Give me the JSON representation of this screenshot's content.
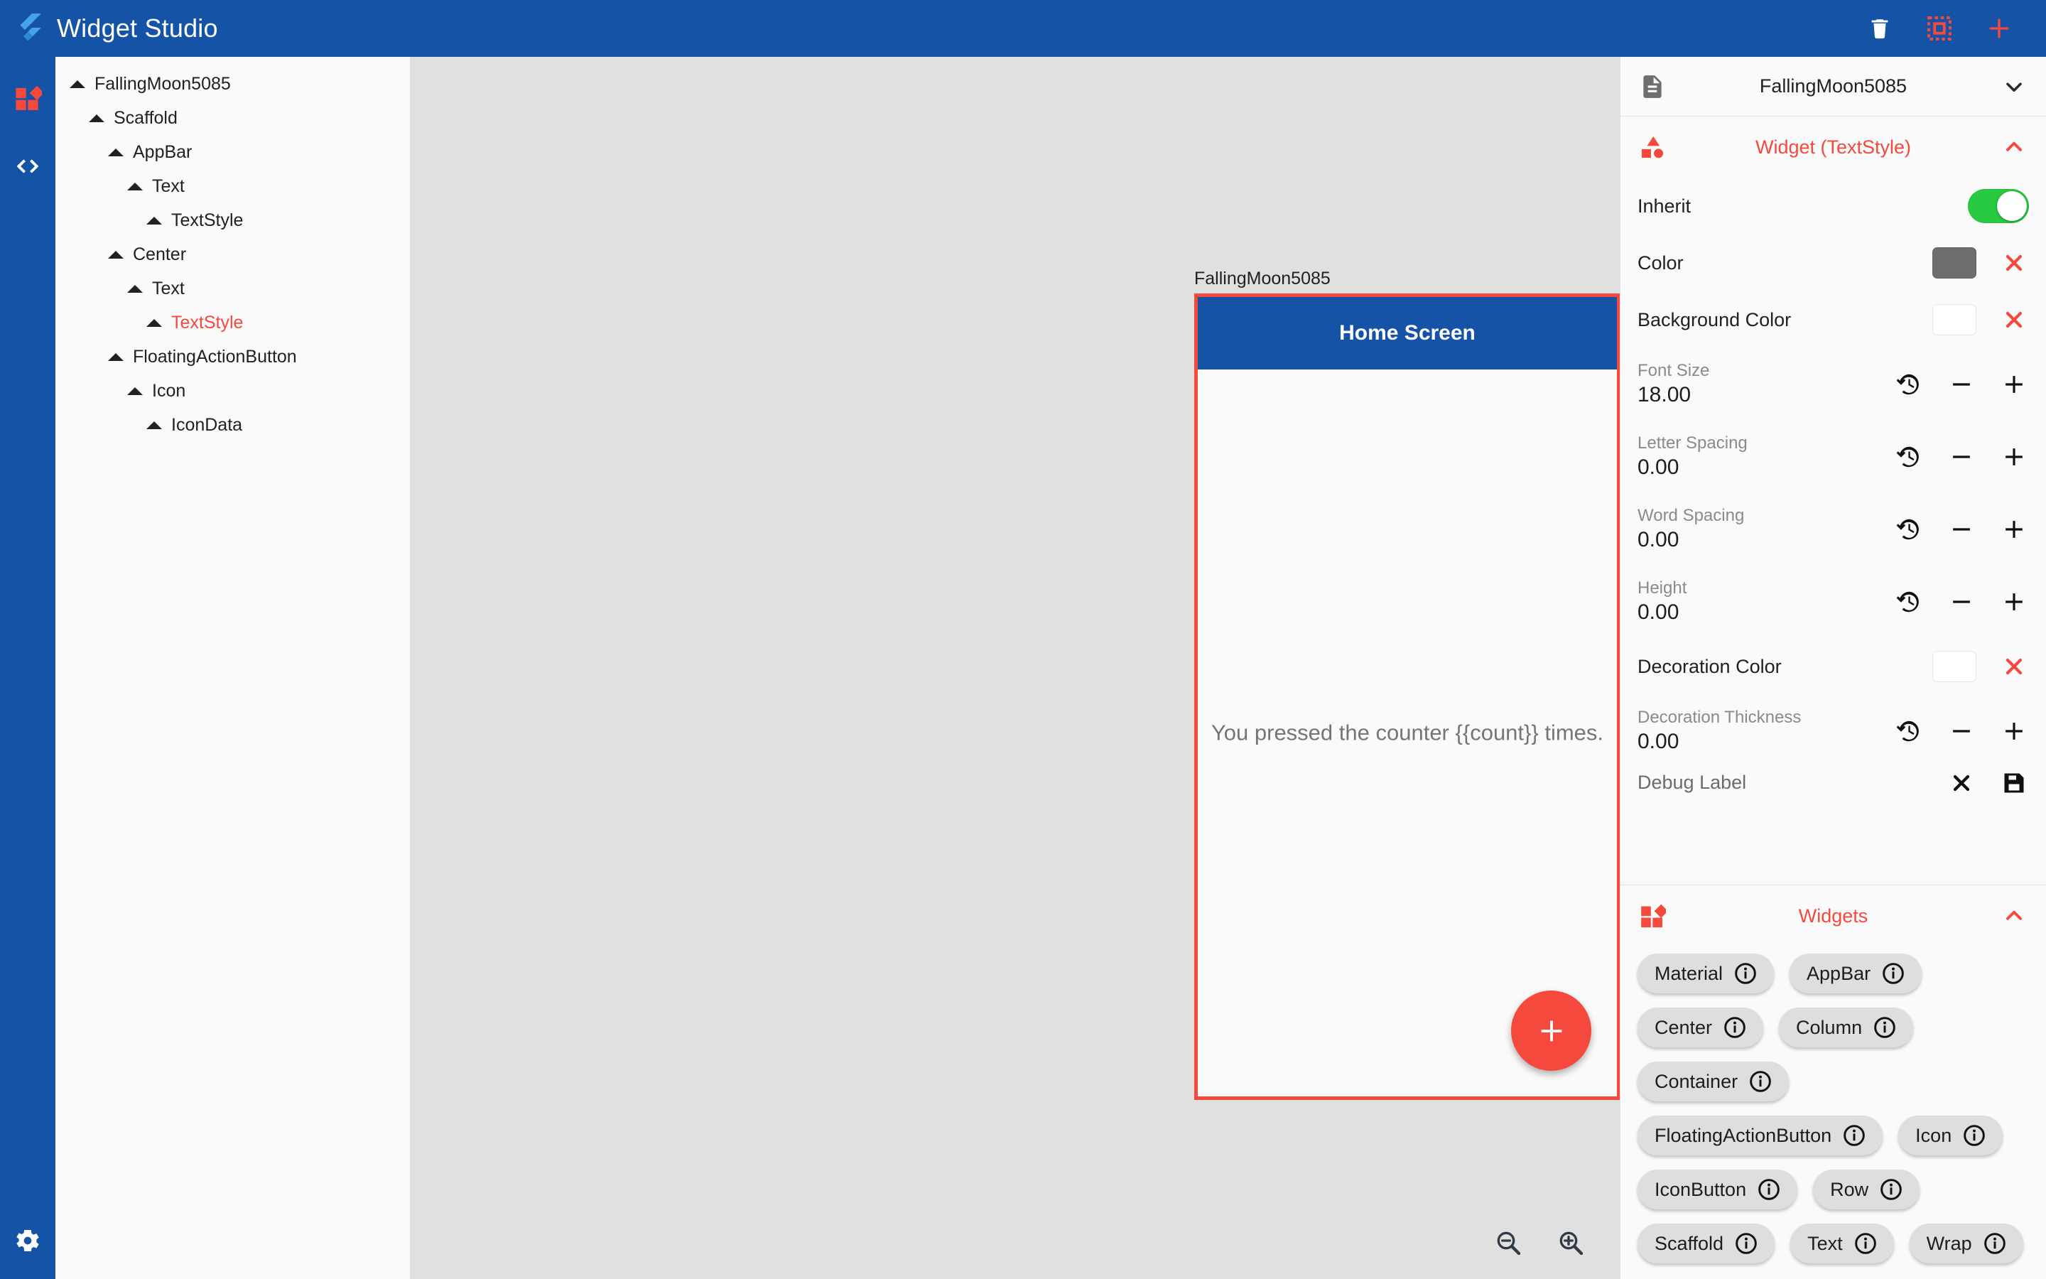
{
  "app": {
    "title": "Widget Studio",
    "brand_color": "#1553a6",
    "accent_color": "#f4493c"
  },
  "topbar": {
    "actions": [
      {
        "name": "delete",
        "icon": "trash-icon"
      },
      {
        "name": "select-region",
        "icon": "dashed-square-icon"
      },
      {
        "name": "add",
        "icon": "plus-icon"
      }
    ]
  },
  "rail": {
    "items": [
      {
        "name": "widgets",
        "icon": "widgets-icon",
        "active": true
      },
      {
        "name": "code",
        "icon": "code-icon",
        "active": false
      }
    ],
    "settings": {
      "name": "settings",
      "icon": "gear-icon"
    }
  },
  "tree": {
    "items": [
      {
        "label": "FallingMoon5085",
        "depth": 0,
        "selected": false
      },
      {
        "label": "Scaffold",
        "depth": 1,
        "selected": false
      },
      {
        "label": "AppBar",
        "depth": 2,
        "selected": false
      },
      {
        "label": "Text",
        "depth": 3,
        "selected": false
      },
      {
        "label": "TextStyle",
        "depth": 4,
        "selected": false
      },
      {
        "label": "Center",
        "depth": 2,
        "selected": false
      },
      {
        "label": "Text",
        "depth": 3,
        "selected": false
      },
      {
        "label": "TextStyle",
        "depth": 4,
        "selected": true
      },
      {
        "label": "FloatingActionButton",
        "depth": 2,
        "selected": false
      },
      {
        "label": "Icon",
        "depth": 3,
        "selected": false
      },
      {
        "label": "IconData",
        "depth": 4,
        "selected": false
      }
    ]
  },
  "canvas": {
    "device_label": "FallingMoon5085",
    "appbar_title": "Home Screen",
    "center_text": "You pressed the counter {{count}} times.",
    "fab_icon": "plus-icon",
    "zoom_out": "zoom-out-icon",
    "zoom_in": "zoom-in-icon"
  },
  "inspector": {
    "header": {
      "title": "FallingMoon5085",
      "icon": "document-icon",
      "chevron": "chevron-down-icon"
    },
    "widget_section": {
      "title": "Widget (TextStyle)",
      "icon": "shapes-icon",
      "chevron": "chevron-up-icon"
    },
    "properties": [
      {
        "label": "Inherit",
        "type": "toggle",
        "value": "on"
      },
      {
        "label": "Color",
        "type": "color",
        "value": "#6e6e6e"
      },
      {
        "label": "Background Color",
        "type": "color",
        "value": "#ffffff"
      },
      {
        "label": "Font Size",
        "type": "number",
        "value": "18.00"
      },
      {
        "label": "Letter Spacing",
        "type": "number",
        "value": "0.00"
      },
      {
        "label": "Word Spacing",
        "type": "number",
        "value": "0.00"
      },
      {
        "label": "Height",
        "type": "number",
        "value": "0.00"
      },
      {
        "label": "Decoration Color",
        "type": "color",
        "value": "#ffffff"
      },
      {
        "label": "Decoration Thickness",
        "type": "number",
        "value": "0.00"
      },
      {
        "label": "Debug Label",
        "type": "text-clipped",
        "value": ""
      }
    ],
    "widgets_section": {
      "title": "Widgets",
      "icon": "widgets-icon",
      "chevron": "chevron-up-icon",
      "chips": [
        "Material",
        "AppBar",
        "Center",
        "Column",
        "Container",
        "FloatingActionButton",
        "Icon",
        "IconButton",
        "Row",
        "Scaffold",
        "Text",
        "Wrap"
      ]
    }
  }
}
